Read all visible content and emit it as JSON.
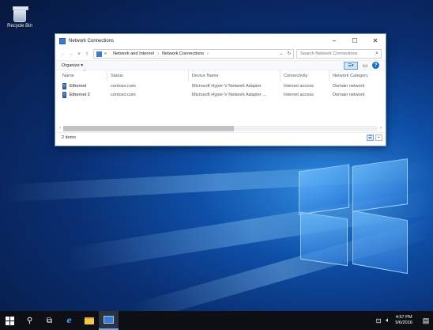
{
  "desktop": {
    "recycle_bin_label": "Recycle Bin"
  },
  "window": {
    "title": "Network Connections",
    "controls": {
      "minimize": "–",
      "maximize": "☐",
      "close": "✕"
    },
    "address": {
      "crumbs": [
        "Network and Internet",
        "Network Connections"
      ],
      "prefix": "«"
    },
    "search": {
      "placeholder": "Search Network Connections"
    },
    "toolbar": {
      "organize_label": "Organize ▾"
    },
    "columns": [
      "Name",
      "Status",
      "Device Name",
      "Connectivity",
      "Network Category"
    ],
    "rows": [
      {
        "name": "Ethernet",
        "status": "contoso.com",
        "device": "Microsoft Hyper-V Network Adapter",
        "connectivity": "Internet access",
        "category": "Domain network"
      },
      {
        "name": "Ethernet 2",
        "status": "contoso.com",
        "device": "Microsoft Hyper-V Network Adapter ...",
        "connectivity": "Internet access",
        "category": "Domain network"
      }
    ],
    "status_text": "2 items"
  },
  "taskbar": {
    "time": "4:57 PM",
    "date": "9/6/2016"
  },
  "icons": [
    "recycle-bin-icon",
    "network-connections-icon",
    "back-arrow-icon",
    "forward-arrow-icon",
    "up-arrow-icon",
    "refresh-icon",
    "search-icon",
    "help-icon",
    "start-icon",
    "cortana-search-icon",
    "task-view-icon",
    "edge-icon",
    "file-explorer-icon",
    "network-icon",
    "volume-icon",
    "notification-icon"
  ]
}
